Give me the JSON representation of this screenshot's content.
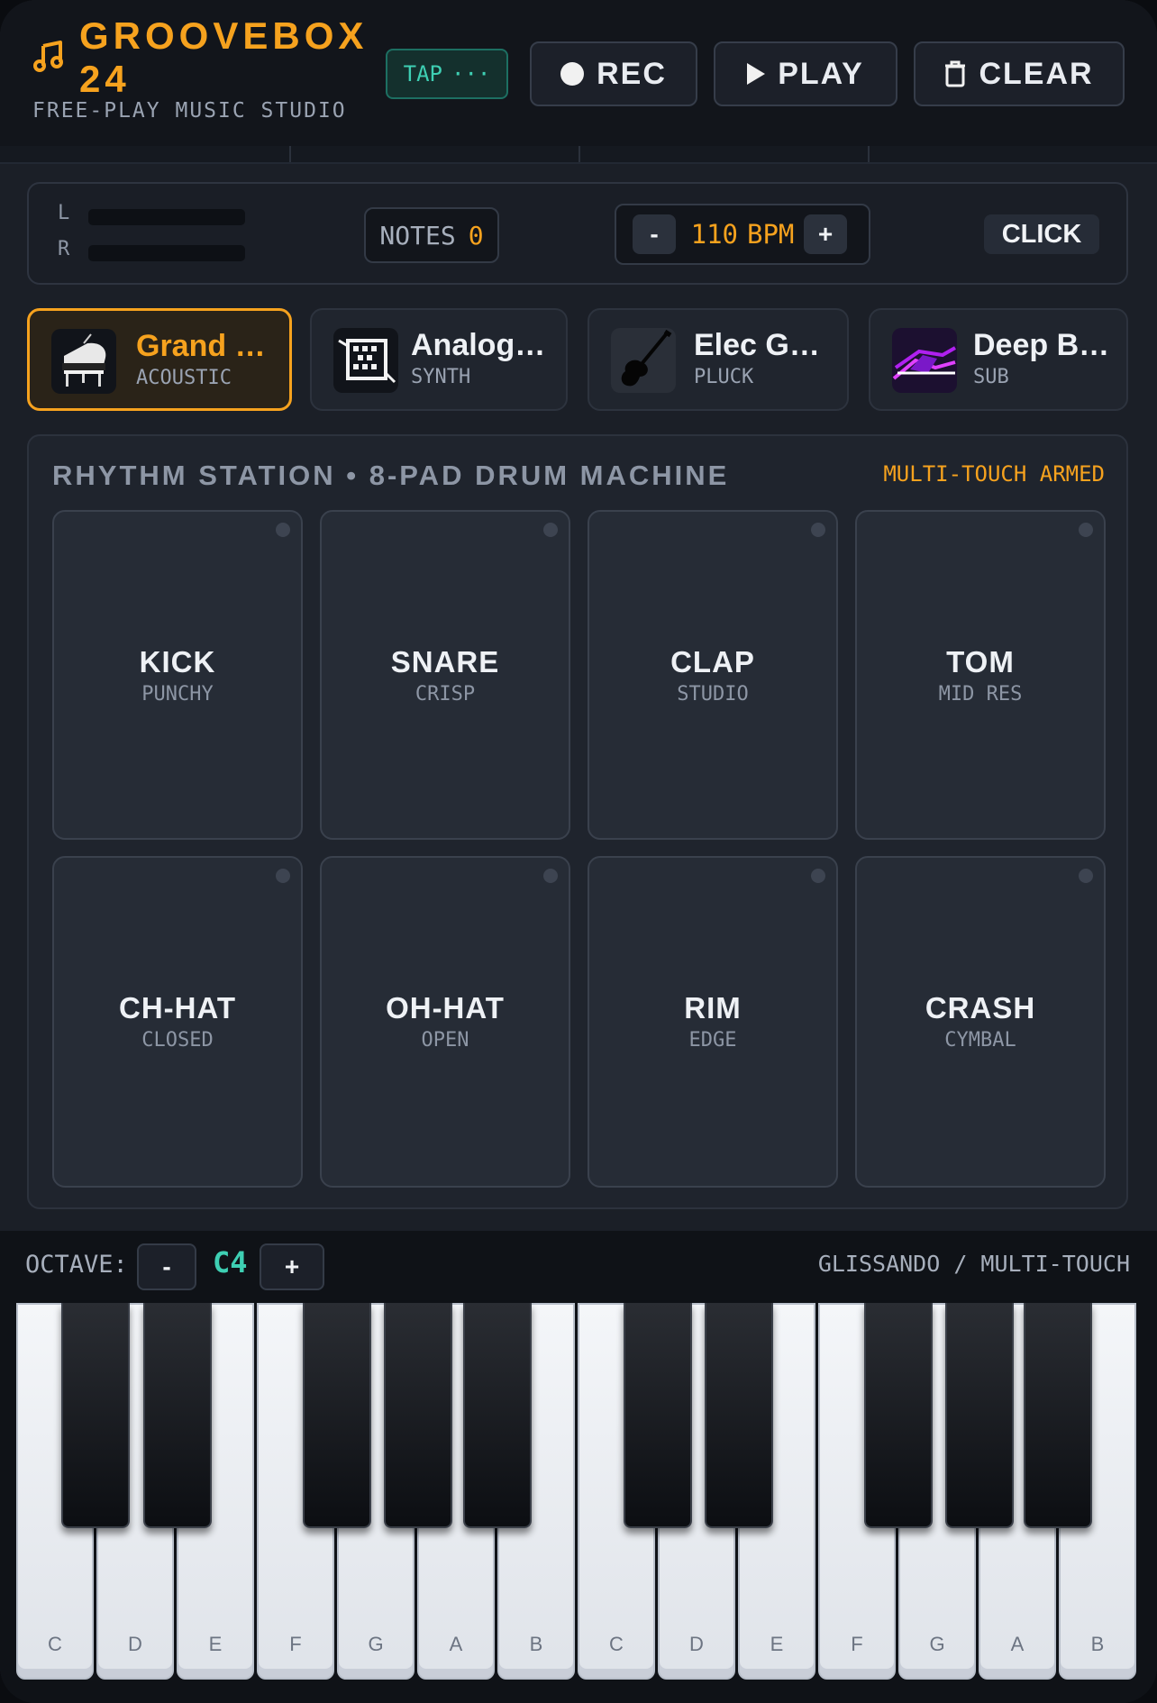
{
  "header": {
    "brand_title": "GROOVEBOX 24",
    "brand_subtitle": "FREE-PLAY MUSIC STUDIO",
    "tap_label": "TAP",
    "tap_dots": "···",
    "rec_label": "REC",
    "play_label": "PLAY",
    "clear_label": "CLEAR"
  },
  "status": {
    "meter_left_label": "L",
    "meter_right_label": "R",
    "meter_left_level": 0,
    "meter_right_level": 0,
    "notes_label": "NOTES",
    "notes_value": "0",
    "bpm_minus": "-",
    "bpm_value": "110",
    "bpm_unit": "BPM",
    "bpm_plus": "+",
    "click_label": "CLICK"
  },
  "instruments": [
    {
      "name": "Grand …",
      "type": "ACOUSTIC",
      "active": true
    },
    {
      "name": "Analog…",
      "type": "SYNTH",
      "active": false
    },
    {
      "name": "Elec G…",
      "type": "PLUCK",
      "active": false
    },
    {
      "name": "Deep B…",
      "type": "SUB",
      "active": false
    }
  ],
  "drum": {
    "title": "RHYTHM STATION • 8-PAD DRUM MACHINE",
    "status": "MULTI-TOUCH ARMED",
    "pads": [
      {
        "name": "KICK",
        "sub": "PUNCHY"
      },
      {
        "name": "SNARE",
        "sub": "CRISP"
      },
      {
        "name": "CLAP",
        "sub": "STUDIO"
      },
      {
        "name": "TOM",
        "sub": "MID RES"
      },
      {
        "name": "CH-HAT",
        "sub": "CLOSED"
      },
      {
        "name": "OH-HAT",
        "sub": "OPEN"
      },
      {
        "name": "RIM",
        "sub": "EDGE"
      },
      {
        "name": "CRASH",
        "sub": "CYMBAL"
      }
    ]
  },
  "keyboard": {
    "octave_label": "OCTAVE:",
    "octave_minus": "-",
    "octave_value": "C4",
    "octave_plus": "+",
    "mode_label": "GLISSANDO / MULTI-TOUCH",
    "white_keys": [
      "C",
      "D",
      "E",
      "F",
      "G",
      "A",
      "B",
      "C",
      "D",
      "E",
      "F",
      "G",
      "A",
      "B"
    ]
  },
  "colors": {
    "accent": "#f6a21e",
    "teal": "#3ecfb3",
    "panel": "#1f242d",
    "background": "#1b1f27"
  },
  "icons": {
    "logo": "music-note-icon",
    "rec": "record-dot-icon",
    "play": "play-icon",
    "clear": "trash-icon"
  }
}
